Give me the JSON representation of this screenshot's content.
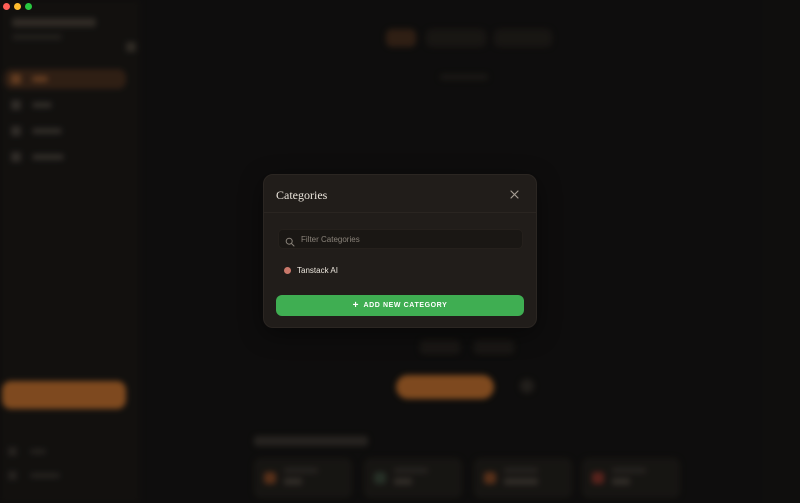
{
  "colors": {
    "accent_green": "#3fae52",
    "category_dot": "#c9786a",
    "traffic_close": "#ff5f57",
    "traffic_minimize": "#febc2e",
    "traffic_maximize": "#28c840"
  },
  "window": {
    "controls": [
      "close",
      "minimize",
      "maximize"
    ]
  },
  "modal": {
    "title": "Categories",
    "close_icon": "close-icon",
    "search": {
      "icon": "search-icon",
      "placeholder": "Filter Categories",
      "value": ""
    },
    "categories": [
      {
        "label": "Tanstack AI",
        "color": "#c9786a"
      }
    ],
    "add_button": {
      "icon": "plus-icon",
      "label": "ADD NEW CATEGORY"
    }
  }
}
